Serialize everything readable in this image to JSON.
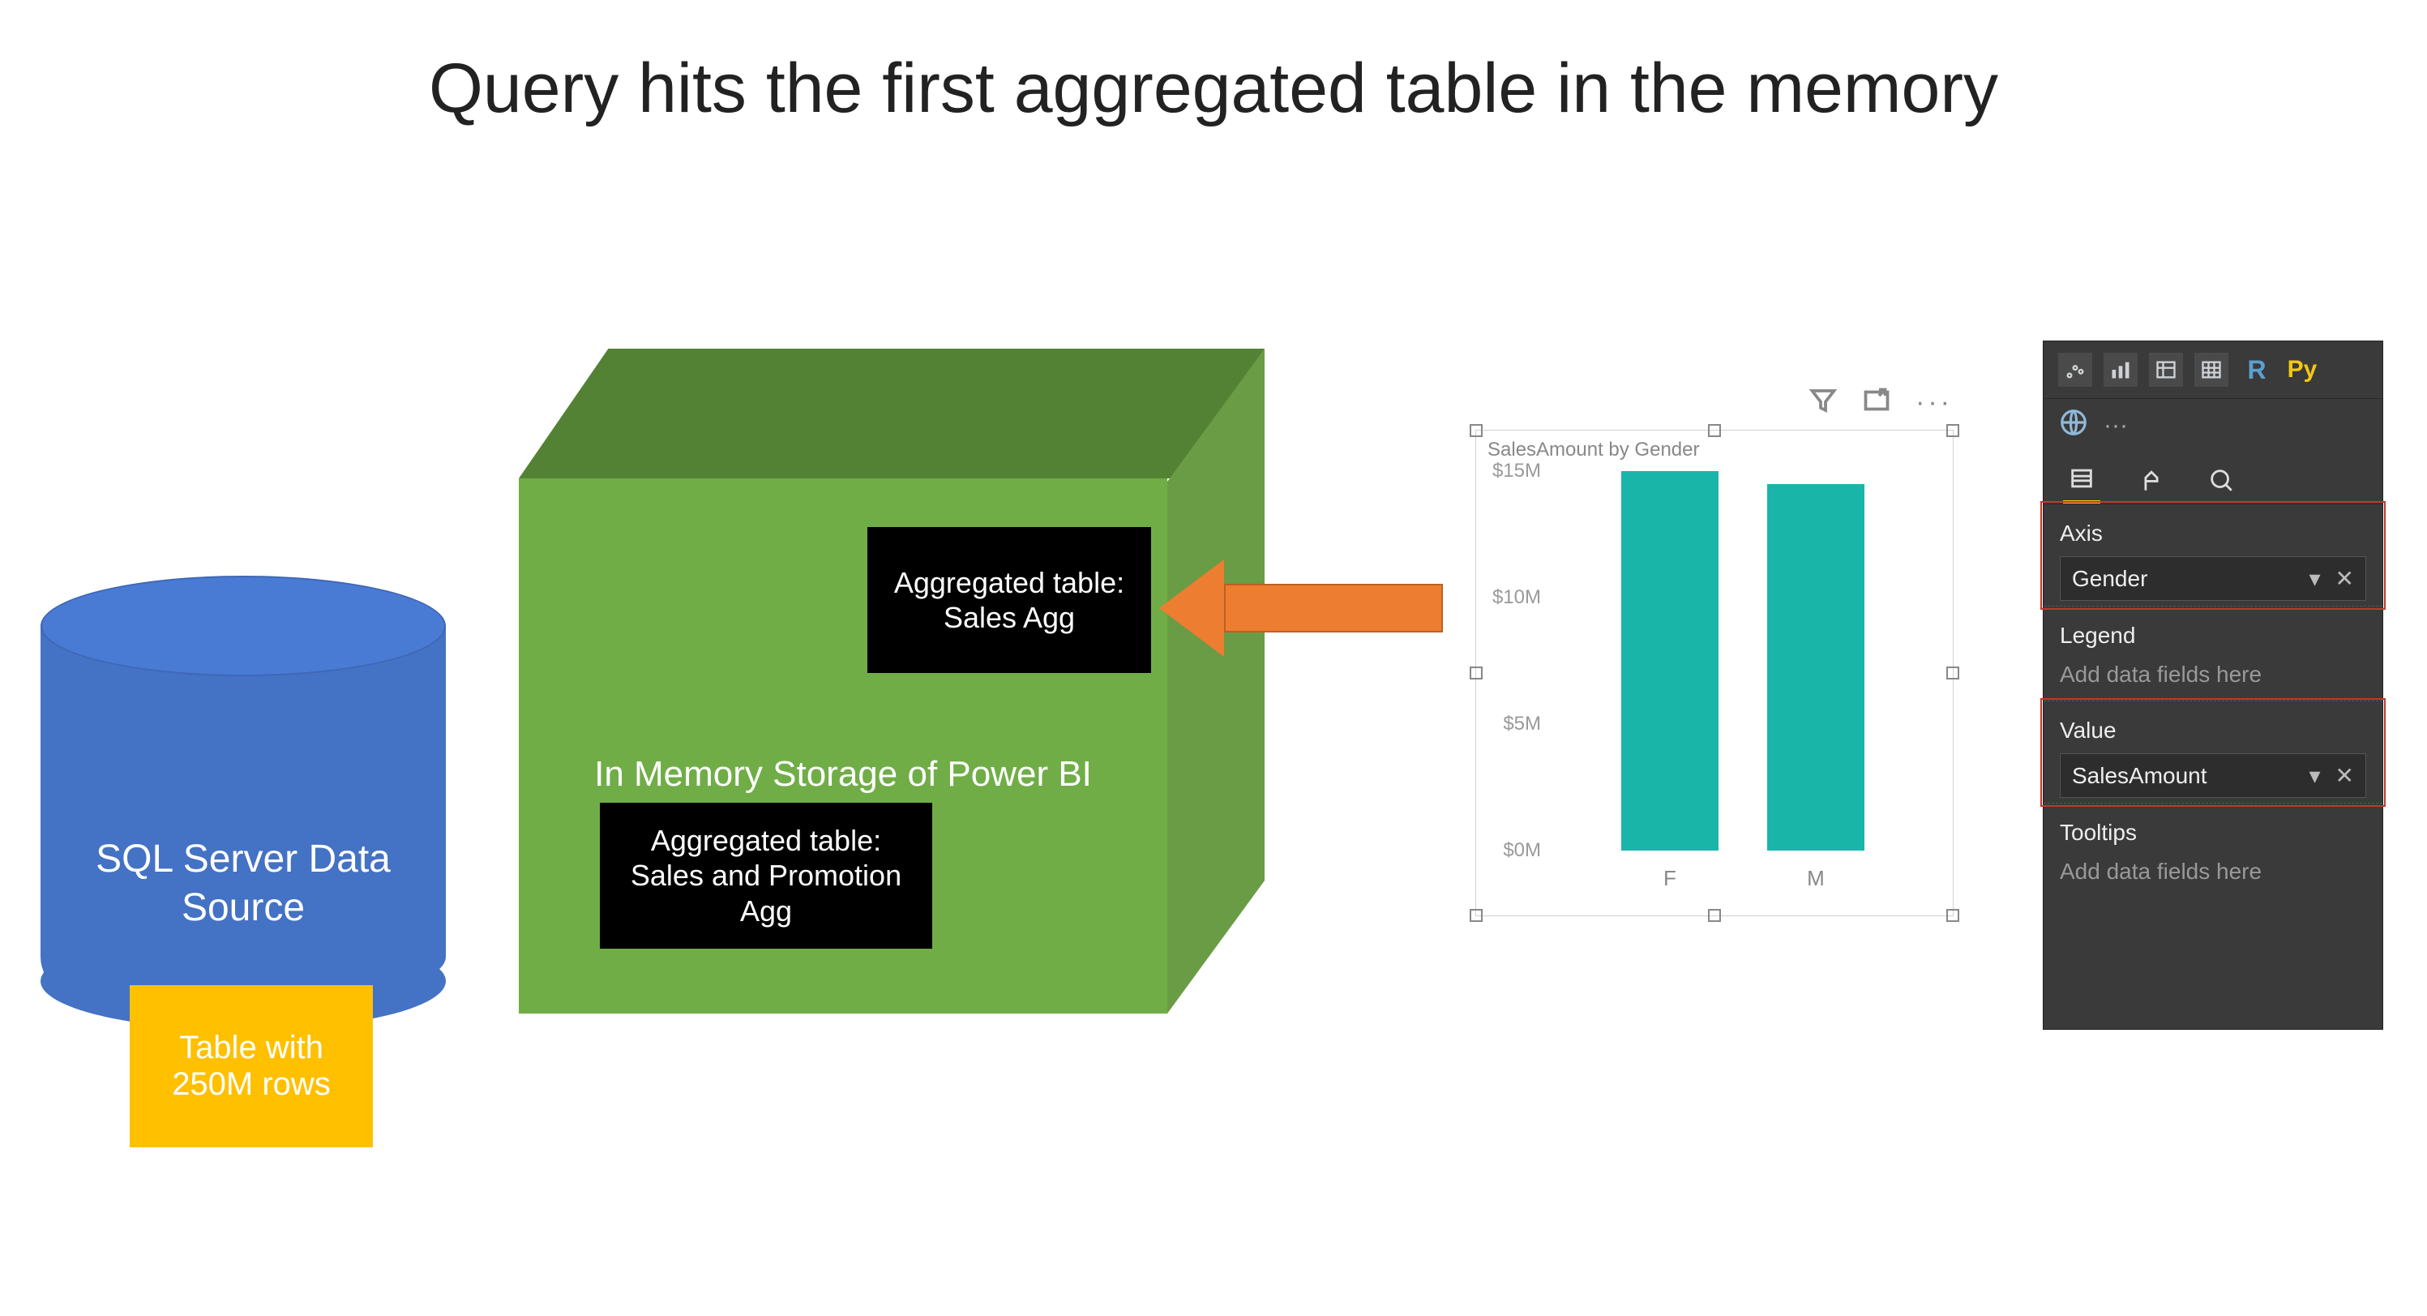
{
  "title": "Query hits the first aggregated table in the memory",
  "sql_source": {
    "label": "SQL Server Data Source",
    "table_badge": "Table with 250M rows"
  },
  "cube": {
    "title": "In Memory Storage of Power BI",
    "agg1": "Aggregated table: Sales Agg",
    "agg2": "Aggregated table: Sales and Promotion  Agg"
  },
  "chart_visual": {
    "title": "SalesAmount by Gender",
    "toolbar_icons": [
      "filter",
      "focus-mode",
      "more"
    ]
  },
  "chart_data": {
    "type": "bar",
    "title": "SalesAmount by Gender",
    "xlabel": "Gender",
    "ylabel": "SalesAmount",
    "categories": [
      "F",
      "M"
    ],
    "values": [
      15000000,
      14500000
    ],
    "ylim": [
      0,
      15000000
    ],
    "y_ticks": [
      "$0M",
      "$5M",
      "$10M",
      "$15M"
    ],
    "y_tick_values": [
      0,
      5000000,
      10000000,
      15000000
    ]
  },
  "format_panel": {
    "viz_icons": [
      "scatter",
      "combo",
      "table",
      "matrix"
    ],
    "r_label": "R",
    "py_label": "Py",
    "more": "···",
    "wells": {
      "axis": {
        "label": "Axis",
        "field": "Gender"
      },
      "legend": {
        "label": "Legend",
        "placeholder": "Add data fields here"
      },
      "values": {
        "label": "Value",
        "field": "SalesAmount"
      },
      "tooltips": {
        "label": "Tooltips",
        "placeholder": "Add data fields here"
      }
    }
  }
}
